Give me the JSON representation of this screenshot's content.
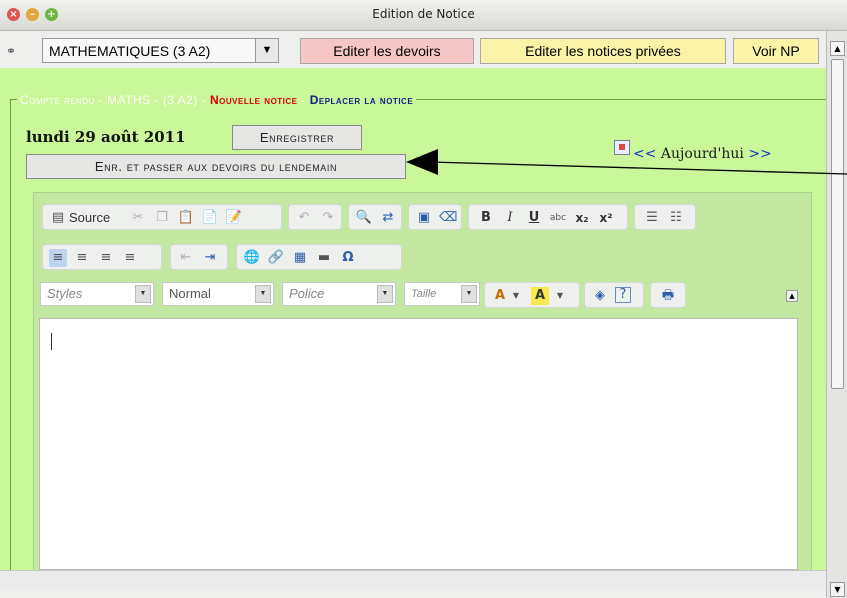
{
  "window": {
    "title": "Edition de Notice"
  },
  "toolbar": {
    "chain_icon": "chain-link-icon",
    "class_select": {
      "value": "MATHEMATIQUES (3 A2)",
      "arrow": "▼"
    },
    "buttons": {
      "edit_devoirs": "Editer les devoirs",
      "edit_notices": "Editer les notices privées",
      "voir_np": "Voir NP"
    },
    "colors": {
      "devoirs": "#f7c6c6",
      "notices": "#f8f3a7",
      "np": "#f8f3a7"
    }
  },
  "panel": {
    "background": "#c9f79a",
    "legend": {
      "part1": "Compte rendu - MATHS - (3 A2)",
      "sep": " - ",
      "part2": "Nouvelle notice",
      "part3": "Deplacer la notice"
    },
    "date": "lundi 29 août 2011",
    "buttons": {
      "enregistrer": "Enregistrer",
      "enr_passer": "Enr. et passer aux devoirs du lendemain"
    },
    "nav": {
      "prev": "<<",
      "today": "Aujourd'hui",
      "next": ">>",
      "calendar_icon": "calendar-icon"
    }
  },
  "editor": {
    "toolbar_row1": {
      "source_label": "Source",
      "icons": [
        "source-icon",
        "cut-icon",
        "copy-icon",
        "paste-icon",
        "paste-text-icon",
        "paste-word-icon",
        "undo-icon",
        "redo-icon",
        "find-icon",
        "replace-icon",
        "select-all-icon",
        "remove-format-icon",
        "bold-icon",
        "italic-icon",
        "underline-icon",
        "strike-icon",
        "subscript-icon",
        "superscript-icon",
        "numbered-list-icon",
        "bulleted-list-icon"
      ]
    },
    "toolbar_row2": {
      "icons": [
        "align-left-icon",
        "align-center-icon",
        "align-right-icon",
        "justify-icon",
        "outdent-icon",
        "indent-icon",
        "link-icon",
        "unlink-icon",
        "table-icon",
        "horizontal-rule-icon",
        "special-char-icon"
      ]
    },
    "toolbar_row3": {
      "styles": "Styles",
      "format": "Normal",
      "font": "Police",
      "size": "Taille",
      "icons": [
        "text-color-icon",
        "bg-color-icon",
        "maximize-icon",
        "about-icon",
        "print-icon"
      ]
    },
    "glyphs": {
      "ic_cut": "✂",
      "ic_copy": "❐",
      "ic_paste": "📋",
      "ic_pastet": "📄",
      "ic_pastew": "📝",
      "ic_undo": "↶",
      "ic_redo": "↷",
      "ic_find": "🔍",
      "ic_replace": "⇄",
      "ic_selall": "▣",
      "ic_erase": "⌫",
      "ic_b": "B",
      "ic_i": "I",
      "ic_u": "U",
      "ic_s": "abc",
      "ic_sub": "x₂",
      "ic_sup": "x²",
      "ic_ol": "☰",
      "ic_ul": "☷",
      "ic_al": "≡",
      "ic_ac": "≡",
      "ic_ar": "≡",
      "ic_aj": "≡",
      "ic_out": "⇤",
      "ic_in": "⇥",
      "ic_link": "🌐",
      "ic_unlink": "🔗",
      "ic_table": "▦",
      "ic_hr": "▬",
      "ic_omega": "Ω",
      "ic_fore": "A",
      "ic_back": "A",
      "ic_max": "◈",
      "ic_about": "?",
      "ic_print": "🖶",
      "dd": "▼",
      "collapse": "▲"
    }
  }
}
